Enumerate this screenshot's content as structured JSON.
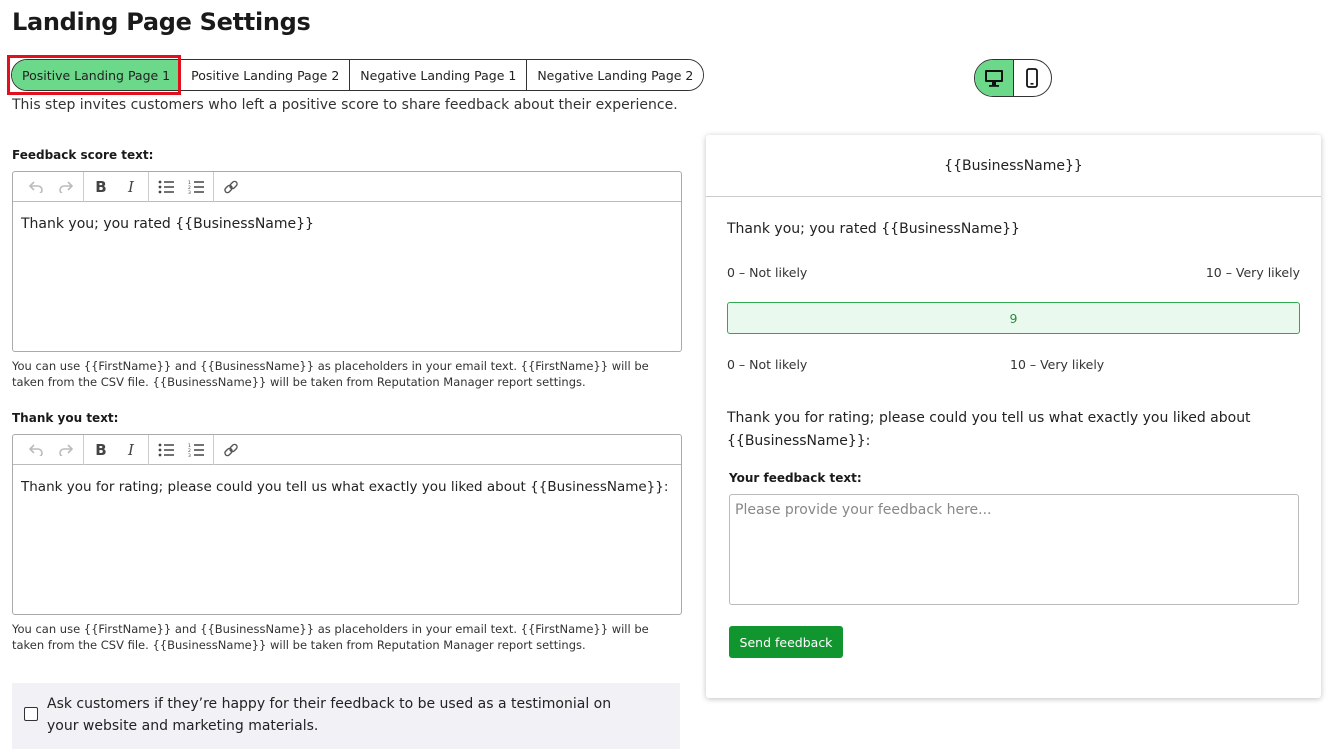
{
  "page_title": "Landing Page Settings",
  "tabs": [
    {
      "label": "Positive Landing Page 1",
      "active": true
    },
    {
      "label": "Positive Landing Page 2",
      "active": false
    },
    {
      "label": "Negative Landing Page 1",
      "active": false
    },
    {
      "label": "Negative Landing Page 2",
      "active": false
    }
  ],
  "intro_text": "This step invites customers who left a positive score to share feedback about their experience.",
  "feedback_score": {
    "label": "Feedback score text:",
    "value": "Thank you; you rated {{BusinessName}}",
    "help_line1": "You can use {{FirstName}} and {{BusinessName}} as placeholders in your email text. {{FirstName}} will be",
    "help_line2": "taken from the CSV file. {{BusinessName}} will be taken from Reputation Manager report settings."
  },
  "thank_you": {
    "label": "Thank you text:",
    "value": "Thank you for rating; please could you tell us what exactly you liked about {{BusinessName}}:",
    "help_line1": "You can use {{FirstName}} and {{BusinessName}} as placeholders in your email text. {{FirstName}} will be",
    "help_line2": "taken from the CSV file. {{BusinessName}} will be taken from Reputation Manager report settings."
  },
  "toolbar_icons": [
    "undo-icon",
    "redo-icon",
    "bold-icon",
    "italic-icon",
    "bullet-list-icon",
    "numbered-list-icon",
    "link-icon"
  ],
  "testimonial_checkbox": {
    "label": "Ask customers if they’re happy for their feedback to be used as a testimonial on your website and marketing materials.",
    "checked": false
  },
  "device_toggle": {
    "options": [
      "desktop-icon",
      "mobile-icon"
    ],
    "selected": "desktop"
  },
  "preview": {
    "header": "{{BusinessName}}",
    "score_text": "Thank you; you rated {{BusinessName}}",
    "scale_low": "0 – Not likely",
    "scale_high": "10 – Very likely",
    "selected_score": "9",
    "scale_low_2": "0 – Not likely",
    "scale_high_2": "10 – Very likely",
    "question": "Thank you for rating; please could you tell us what exactly you liked about {{BusinessName}}:",
    "feedback_label": "Your feedback text:",
    "feedback_placeholder": "Please provide your feedback here...",
    "send_button": "Send feedback"
  },
  "colors": {
    "accent_green": "#6cd88a",
    "button_green": "#11962f",
    "highlight_red": "#e0101c"
  }
}
